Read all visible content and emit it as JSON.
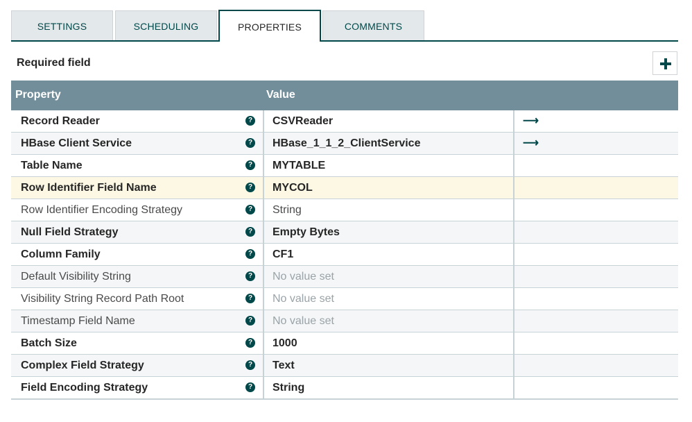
{
  "tabs": [
    {
      "label": "SETTINGS",
      "active": false
    },
    {
      "label": "SCHEDULING",
      "active": false
    },
    {
      "label": "PROPERTIES",
      "active": true
    },
    {
      "label": "COMMENTS",
      "active": false
    }
  ],
  "toolbar": {
    "required_label": "Required field",
    "add_icon": "plus-icon"
  },
  "grid": {
    "headers": {
      "property": "Property",
      "value": "Value"
    },
    "rows": [
      {
        "name": "Record Reader",
        "value": "CSVReader",
        "required": true,
        "unset": false,
        "goto": true
      },
      {
        "name": "HBase Client Service",
        "value": "HBase_1_1_2_ClientService",
        "required": true,
        "unset": false,
        "goto": true
      },
      {
        "name": "Table Name",
        "value": "MYTABLE",
        "required": true,
        "unset": false,
        "goto": false
      },
      {
        "name": "Row Identifier Field Name",
        "value": "MYCOL",
        "required": true,
        "unset": false,
        "goto": false,
        "highlighted": true
      },
      {
        "name": "Row Identifier Encoding Strategy",
        "value": "String",
        "required": false,
        "unset": false,
        "goto": false
      },
      {
        "name": "Null Field Strategy",
        "value": "Empty Bytes",
        "required": true,
        "unset": false,
        "goto": false
      },
      {
        "name": "Column Family",
        "value": "CF1",
        "required": true,
        "unset": false,
        "goto": false
      },
      {
        "name": "Default Visibility String",
        "value": "No value set",
        "required": false,
        "unset": true,
        "goto": false
      },
      {
        "name": "Visibility String Record Path Root",
        "value": "No value set",
        "required": false,
        "unset": true,
        "goto": false
      },
      {
        "name": "Timestamp Field Name",
        "value": "No value set",
        "required": false,
        "unset": true,
        "goto": false
      },
      {
        "name": "Batch Size",
        "value": "1000",
        "required": true,
        "unset": false,
        "goto": false
      },
      {
        "name": "Complex Field Strategy",
        "value": "Text",
        "required": true,
        "unset": false,
        "goto": false
      },
      {
        "name": "Field Encoding Strategy",
        "value": "String",
        "required": true,
        "unset": false,
        "goto": false
      }
    ]
  },
  "icons": {
    "help": "question-circle-icon",
    "goto": "arrow-right-icon"
  },
  "colors": {
    "accent": "#004849",
    "header_bg": "#728e9b",
    "highlight_row": "#fcf8e3"
  }
}
